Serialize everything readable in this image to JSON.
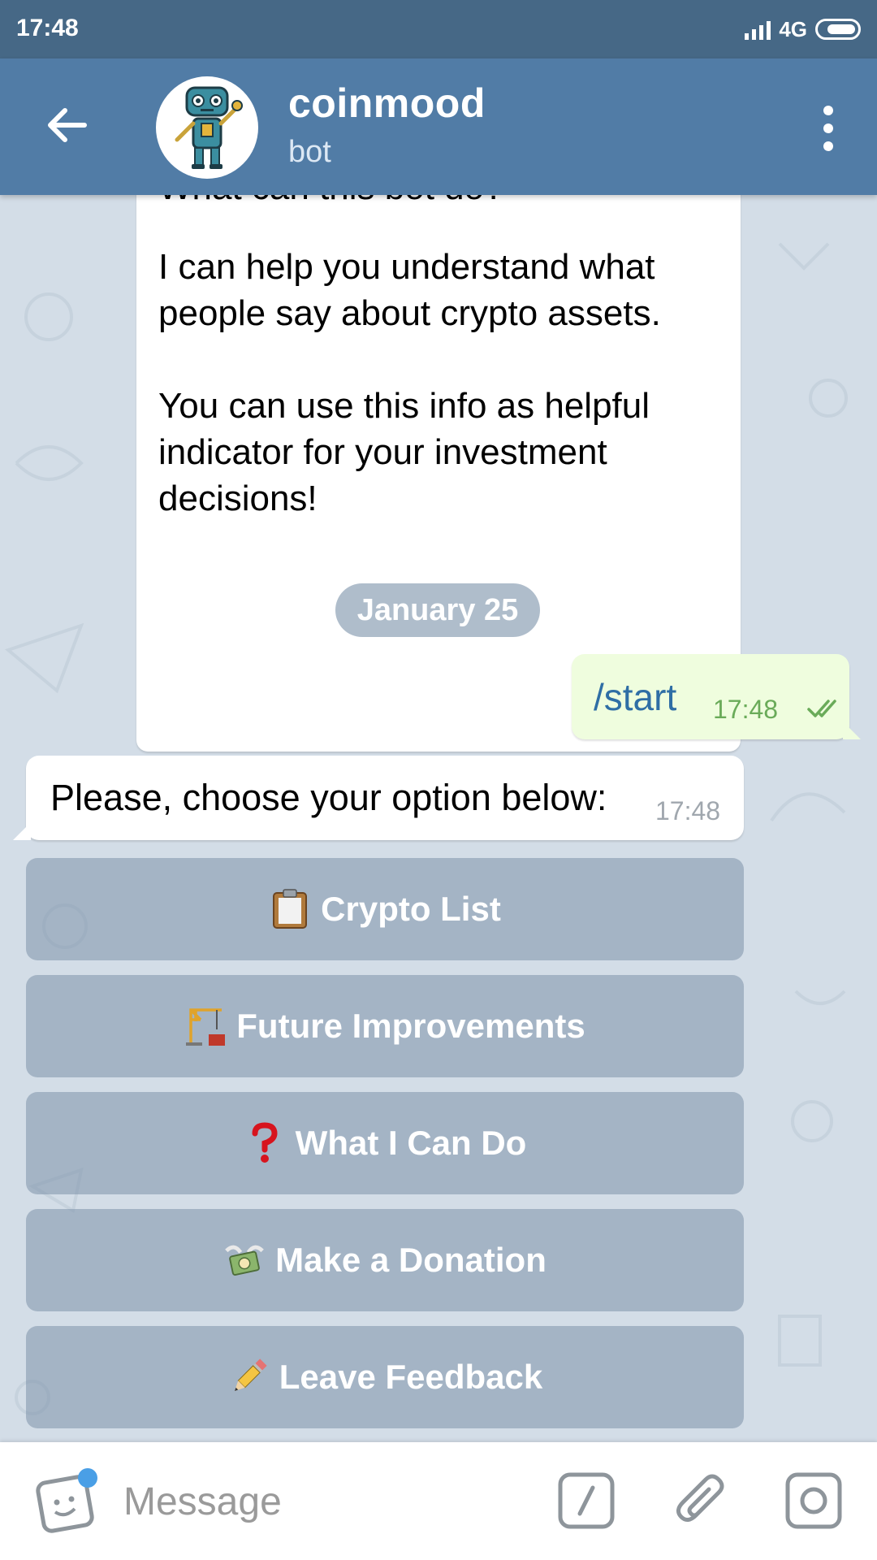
{
  "status_bar": {
    "time": "17:48",
    "network": "4G",
    "icons": [
      "signal-icon",
      "battery-icon"
    ]
  },
  "header": {
    "title": "coinmood",
    "subtitle": "bot",
    "back_icon": "back-arrow-icon",
    "menu_icon": "more-vertical-icon",
    "avatar_icon": "robot-avatar-icon",
    "color": "#517ca6"
  },
  "chat": {
    "bot_info": {
      "heading": "What can this bot do?",
      "paragraph_1_line_1": "I can help you understand what",
      "paragraph_1_line_2": "people say about crypto assets.",
      "paragraph_2_line_1": "You can use this info as helpful",
      "paragraph_2_line_2": "indicator for your investment",
      "paragraph_2_line_3": "decisions!"
    },
    "date_separator": "January 25",
    "outgoing": {
      "text": "/start",
      "time": "17:48",
      "status_icon": "double-check-icon"
    },
    "incoming": {
      "text": "Please, choose your option below:",
      "time": "17:48"
    },
    "keyboard": [
      {
        "label": "Crypto List",
        "icon": "clipboard-icon"
      },
      {
        "label": "Future Improvements",
        "icon": "construction-crane-icon"
      },
      {
        "label": "What I Can Do",
        "icon": "question-mark-icon"
      },
      {
        "label": "Make a Donation",
        "icon": "money-with-wings-icon"
      },
      {
        "label": "Leave Feedback",
        "icon": "pencil-icon"
      }
    ]
  },
  "composer": {
    "placeholder": "Message",
    "icons": [
      "sticker-icon",
      "bot-command-icon",
      "attach-icon",
      "camera-icon"
    ]
  }
}
